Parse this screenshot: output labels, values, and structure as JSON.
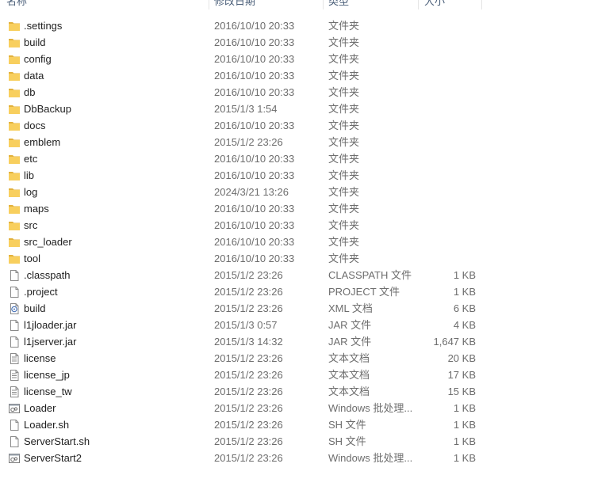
{
  "columns": {
    "name": "名称",
    "date": "修改日期",
    "type": "类型",
    "size": "大小"
  },
  "files": [
    {
      "name": ".settings",
      "date": "2016/10/10 20:33",
      "type": "文件夹",
      "size": "",
      "icon": "folder"
    },
    {
      "name": "build",
      "date": "2016/10/10 20:33",
      "type": "文件夹",
      "size": "",
      "icon": "folder"
    },
    {
      "name": "config",
      "date": "2016/10/10 20:33",
      "type": "文件夹",
      "size": "",
      "icon": "folder"
    },
    {
      "name": "data",
      "date": "2016/10/10 20:33",
      "type": "文件夹",
      "size": "",
      "icon": "folder"
    },
    {
      "name": "db",
      "date": "2016/10/10 20:33",
      "type": "文件夹",
      "size": "",
      "icon": "folder"
    },
    {
      "name": "DbBackup",
      "date": "2015/1/3 1:54",
      "type": "文件夹",
      "size": "",
      "icon": "folder"
    },
    {
      "name": "docs",
      "date": "2016/10/10 20:33",
      "type": "文件夹",
      "size": "",
      "icon": "folder"
    },
    {
      "name": "emblem",
      "date": "2015/1/2 23:26",
      "type": "文件夹",
      "size": "",
      "icon": "folder"
    },
    {
      "name": "etc",
      "date": "2016/10/10 20:33",
      "type": "文件夹",
      "size": "",
      "icon": "folder"
    },
    {
      "name": "lib",
      "date": "2016/10/10 20:33",
      "type": "文件夹",
      "size": "",
      "icon": "folder"
    },
    {
      "name": "log",
      "date": "2024/3/21 13:26",
      "type": "文件夹",
      "size": "",
      "icon": "folder"
    },
    {
      "name": "maps",
      "date": "2016/10/10 20:33",
      "type": "文件夹",
      "size": "",
      "icon": "folder"
    },
    {
      "name": "src",
      "date": "2016/10/10 20:33",
      "type": "文件夹",
      "size": "",
      "icon": "folder"
    },
    {
      "name": "src_loader",
      "date": "2016/10/10 20:33",
      "type": "文件夹",
      "size": "",
      "icon": "folder"
    },
    {
      "name": "tool",
      "date": "2016/10/10 20:33",
      "type": "文件夹",
      "size": "",
      "icon": "folder"
    },
    {
      "name": ".classpath",
      "date": "2015/1/2 23:26",
      "type": "CLASSPATH 文件",
      "size": "1 KB",
      "icon": "file"
    },
    {
      "name": ".project",
      "date": "2015/1/2 23:26",
      "type": "PROJECT 文件",
      "size": "1 KB",
      "icon": "file"
    },
    {
      "name": "build",
      "date": "2015/1/2 23:26",
      "type": "XML 文档",
      "size": "6 KB",
      "icon": "xml"
    },
    {
      "name": "l1jloader.jar",
      "date": "2015/1/3 0:57",
      "type": "JAR 文件",
      "size": "4 KB",
      "icon": "file"
    },
    {
      "name": "l1jserver.jar",
      "date": "2015/1/3 14:32",
      "type": "JAR 文件",
      "size": "1,647 KB",
      "icon": "file"
    },
    {
      "name": "license",
      "date": "2015/1/2 23:26",
      "type": "文本文档",
      "size": "20 KB",
      "icon": "text"
    },
    {
      "name": "license_jp",
      "date": "2015/1/2 23:26",
      "type": "文本文档",
      "size": "17 KB",
      "icon": "text"
    },
    {
      "name": "license_tw",
      "date": "2015/1/2 23:26",
      "type": "文本文档",
      "size": "15 KB",
      "icon": "text"
    },
    {
      "name": "Loader",
      "date": "2015/1/2 23:26",
      "type": "Windows 批处理...",
      "size": "1 KB",
      "icon": "batch"
    },
    {
      "name": "Loader.sh",
      "date": "2015/1/2 23:26",
      "type": "SH 文件",
      "size": "1 KB",
      "icon": "file"
    },
    {
      "name": "ServerStart.sh",
      "date": "2015/1/2 23:26",
      "type": "SH 文件",
      "size": "1 KB",
      "icon": "file"
    },
    {
      "name": "ServerStart2",
      "date": "2015/1/2 23:26",
      "type": "Windows 批处理...",
      "size": "1 KB",
      "icon": "batch"
    }
  ],
  "colors": {
    "folder": "#f8cf5e",
    "folder_dark": "#e2b13c",
    "file_border": "#8a8a8a",
    "header_text": "#4c607a"
  }
}
